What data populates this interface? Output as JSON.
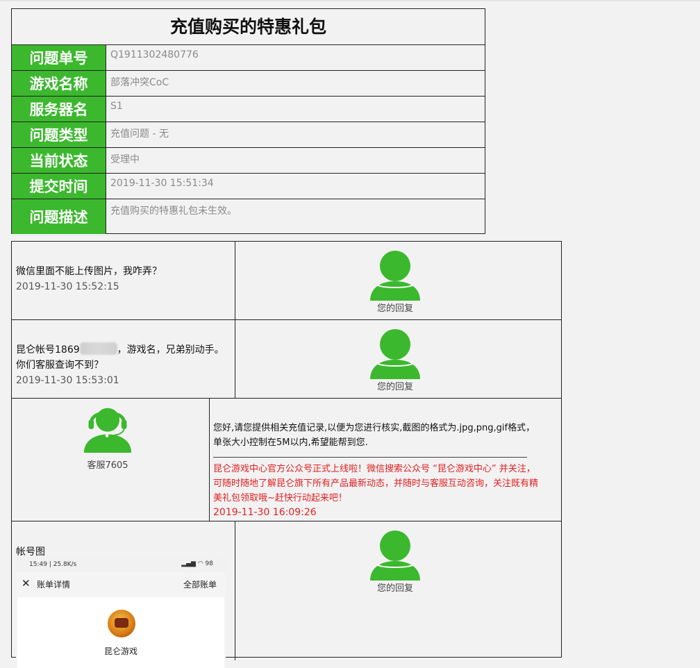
{
  "ticket": {
    "title": "充值购买的特惠礼包",
    "rows": [
      {
        "label": "问题单号",
        "value": "Q1911302480776"
      },
      {
        "label": "游戏名称",
        "value": "部落冲突CoC"
      },
      {
        "label": "服务器名",
        "value": "S1"
      },
      {
        "label": "问题类型",
        "value": "充值问题 - 无"
      },
      {
        "label": "当前状态",
        "value": "受理中"
      },
      {
        "label": "提交时间",
        "value": "2019-11-30 15:51:34"
      },
      {
        "label": "问题描述",
        "value": "充值购买的特惠礼包未生效。"
      }
    ]
  },
  "conversation": {
    "messages": [
      {
        "text": "微信里面不能上传图片，我咋弄？",
        "time": "2019-11-30 15:52:15",
        "reply_caption": "您的回复"
      },
      {
        "text_before": "昆仑帐号1869",
        "text_after": "，游戏名，兄弟别动手。你们客服查询不到？",
        "time": "2019-11-30 15:53:01",
        "reply_caption": "您的回复"
      },
      {
        "agent_name": "客服7605",
        "reply_text": "您好,请您提供相关充值记录,以便为您进行核实,截图的格式为.jpg,png,gif格式，单张大小控制在5M以内,希望能帮到您.",
        "divider": "______________________________________________________________",
        "notice": "昆仑游戏中心官方公众号正式上线啦！微信搜索公众号 “昆仑游戏中心” 并关注，可随时随地了解昆仑旗下所有产品最新动态，并随时与客服互动咨询，关注既有精美礼包领取哦~赶快行动起来吧！",
        "time": "2019-11-30 16:09:26"
      },
      {
        "text": "帐号图",
        "reply_caption": "您的回复",
        "screenshot": {
          "status_left": "15:49 | 25.8K/s",
          "status_right": "98",
          "close": "✕",
          "nav_title": "账单详情",
          "nav_right": "全部账单",
          "game_name": "昆仑游戏"
        }
      }
    ]
  },
  "colors": {
    "accent_green": "#3bb82d",
    "notice_red": "#e02020"
  }
}
